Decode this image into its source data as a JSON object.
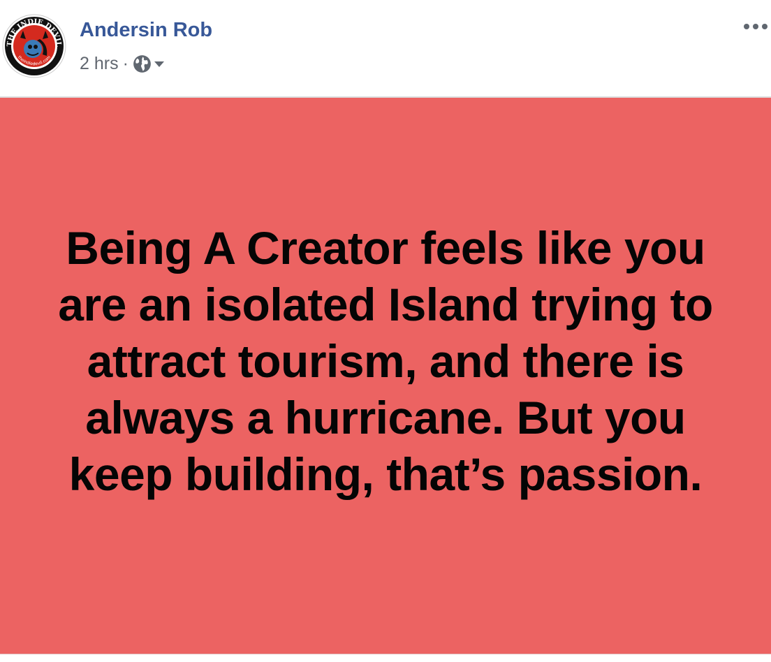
{
  "post": {
    "author": {
      "name": "Andersin Rob",
      "avatar_icon": "indie-devil-logo-avatar",
      "avatar_text_top": "THE INDIE DEVIL",
      "avatar_text_bottom": "theindiedevil.com"
    },
    "meta": {
      "timestamp": "2 hrs",
      "separator": "·",
      "audience_icon": "globe-icon",
      "audience_dropdown_icon": "caret-down-icon"
    },
    "more_options_icon": "ellipsis-icon",
    "status": {
      "text": "Being A Creator feels like you are an isolated Island trying to attract tourism, and there is always a hurricane. But you keep building, that’s passion.",
      "background_color": "#ec6362",
      "text_color": "#050505"
    },
    "colors": {
      "author_link": "#385898",
      "meta_text": "#616770"
    }
  }
}
